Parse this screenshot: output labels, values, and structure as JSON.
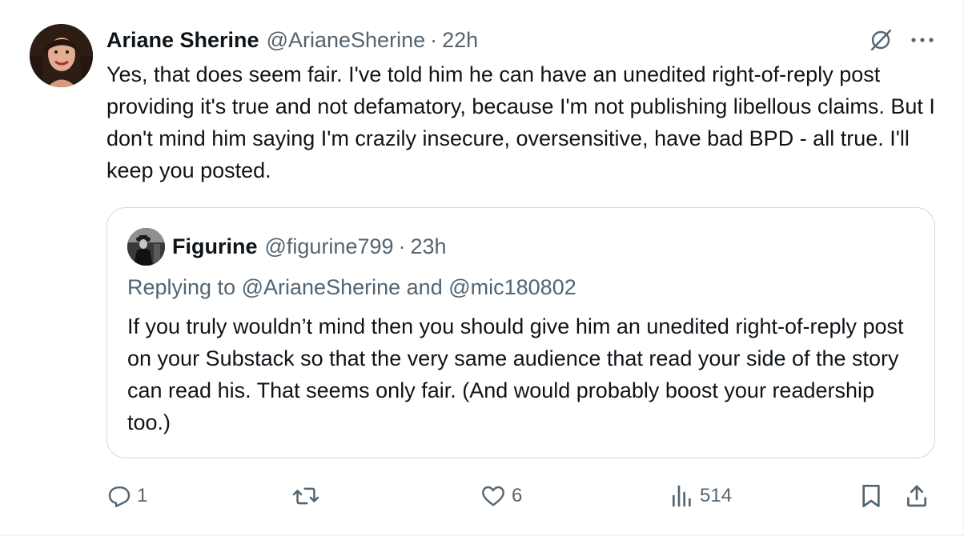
{
  "post": {
    "author_name": "Ariane Sherine",
    "author_handle": "@ArianeSherine",
    "separator": "·",
    "time": "22h",
    "text": "Yes, that does seem fair. I've told him he can have an unedited right-of-reply post providing it's true and not defamatory, because I'm not publishing libellous claims. But I don't mind him saying I'm crazily insecure, oversensitive, have bad BPD - all true. I'll keep you posted.",
    "avatar_icon": "profile-photo-woman"
  },
  "quoted_post": {
    "author_name": "Figurine",
    "author_handle": "@figurine799",
    "separator": "·",
    "time": "23h",
    "replying_prefix": "Replying to",
    "replying_to_1": "@ArianeSherine",
    "replying_and": "and",
    "replying_to_2": "@mic180802",
    "text": "If you truly wouldn’t mind then you should give him an unedited right-of-reply post on your Substack so that the very same audience that read your side of the story can read his. That seems only fair. (And would probably boost your readership too.)",
    "avatar_icon": "profile-photo-figure"
  },
  "actions": {
    "reply_count": "1",
    "repost_count": "",
    "like_count": "6",
    "views_count": "514"
  },
  "icons": {
    "top_right": [
      "grok-icon",
      "more-icon"
    ],
    "actions": [
      "reply-icon",
      "repost-icon",
      "like-icon",
      "views-icon",
      "bookmark-icon",
      "share-icon"
    ]
  },
  "colors": {
    "text_primary": "#0f1419",
    "text_secondary": "#536471",
    "border": "#cfd9de"
  }
}
